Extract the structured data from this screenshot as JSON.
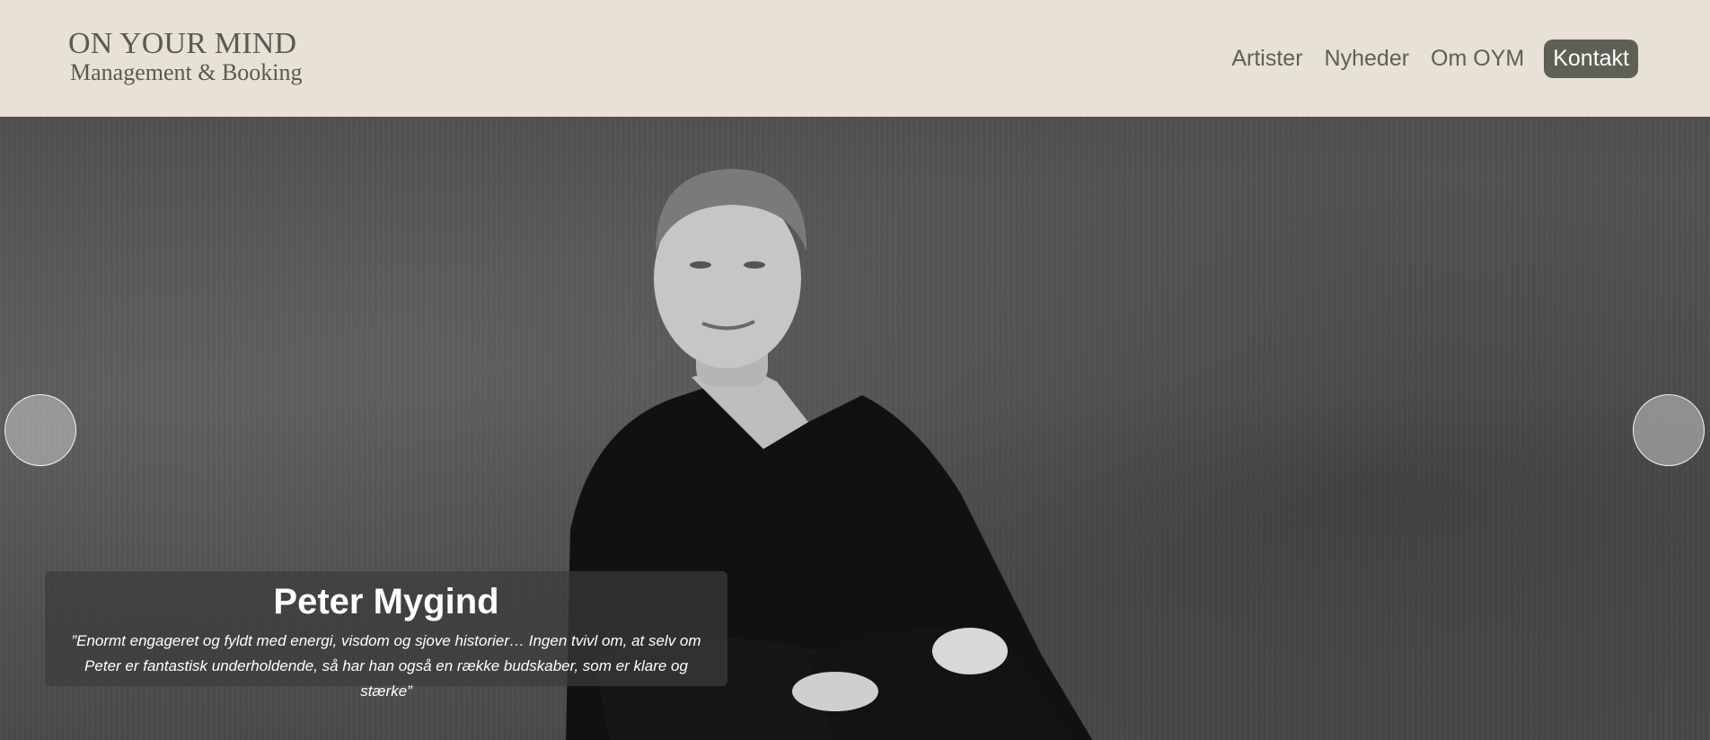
{
  "header": {
    "logo": {
      "line1": "ON YOUR MIND",
      "line2": "Management & Booking"
    },
    "nav": [
      {
        "label": "Artister"
      },
      {
        "label": "Nyheder"
      },
      {
        "label": "Om OYM"
      },
      {
        "label": "Kontakt"
      }
    ]
  },
  "hero": {
    "title": "Peter Mygind",
    "quote": "”Enormt engageret og fyldt med energi, visdom og sjove historier… Ingen tvivl om, at selv om Peter er fantastisk underholdende, så har han også en række budskaber, som er klare og stærke”"
  },
  "colors": {
    "header_bg": "#e8e1d6",
    "nav_text": "#5e6054",
    "cta_bg": "#5f6055"
  }
}
